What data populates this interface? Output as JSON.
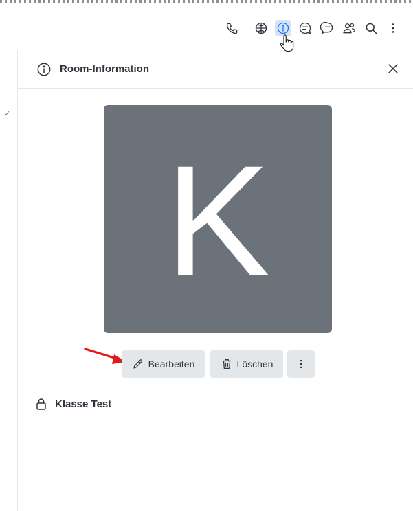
{
  "header": {
    "icons": [
      "phone-icon",
      "globe-icon",
      "info-icon",
      "discussion-icon",
      "threads-icon",
      "members-icon",
      "search-icon",
      "kebab-icon"
    ]
  },
  "panel": {
    "title": "Room-Information",
    "avatar_letter": "K",
    "actions": {
      "edit_label": "Bearbeiten",
      "delete_label": "Löschen"
    },
    "room_name": "Klasse Test"
  },
  "colors": {
    "avatar_bg": "#6c727a",
    "button_bg": "#e4e7ea",
    "active_icon_bg": "#d6e4f8",
    "accent": "#1d74f5",
    "annotation_arrow": "#e01b1b"
  }
}
